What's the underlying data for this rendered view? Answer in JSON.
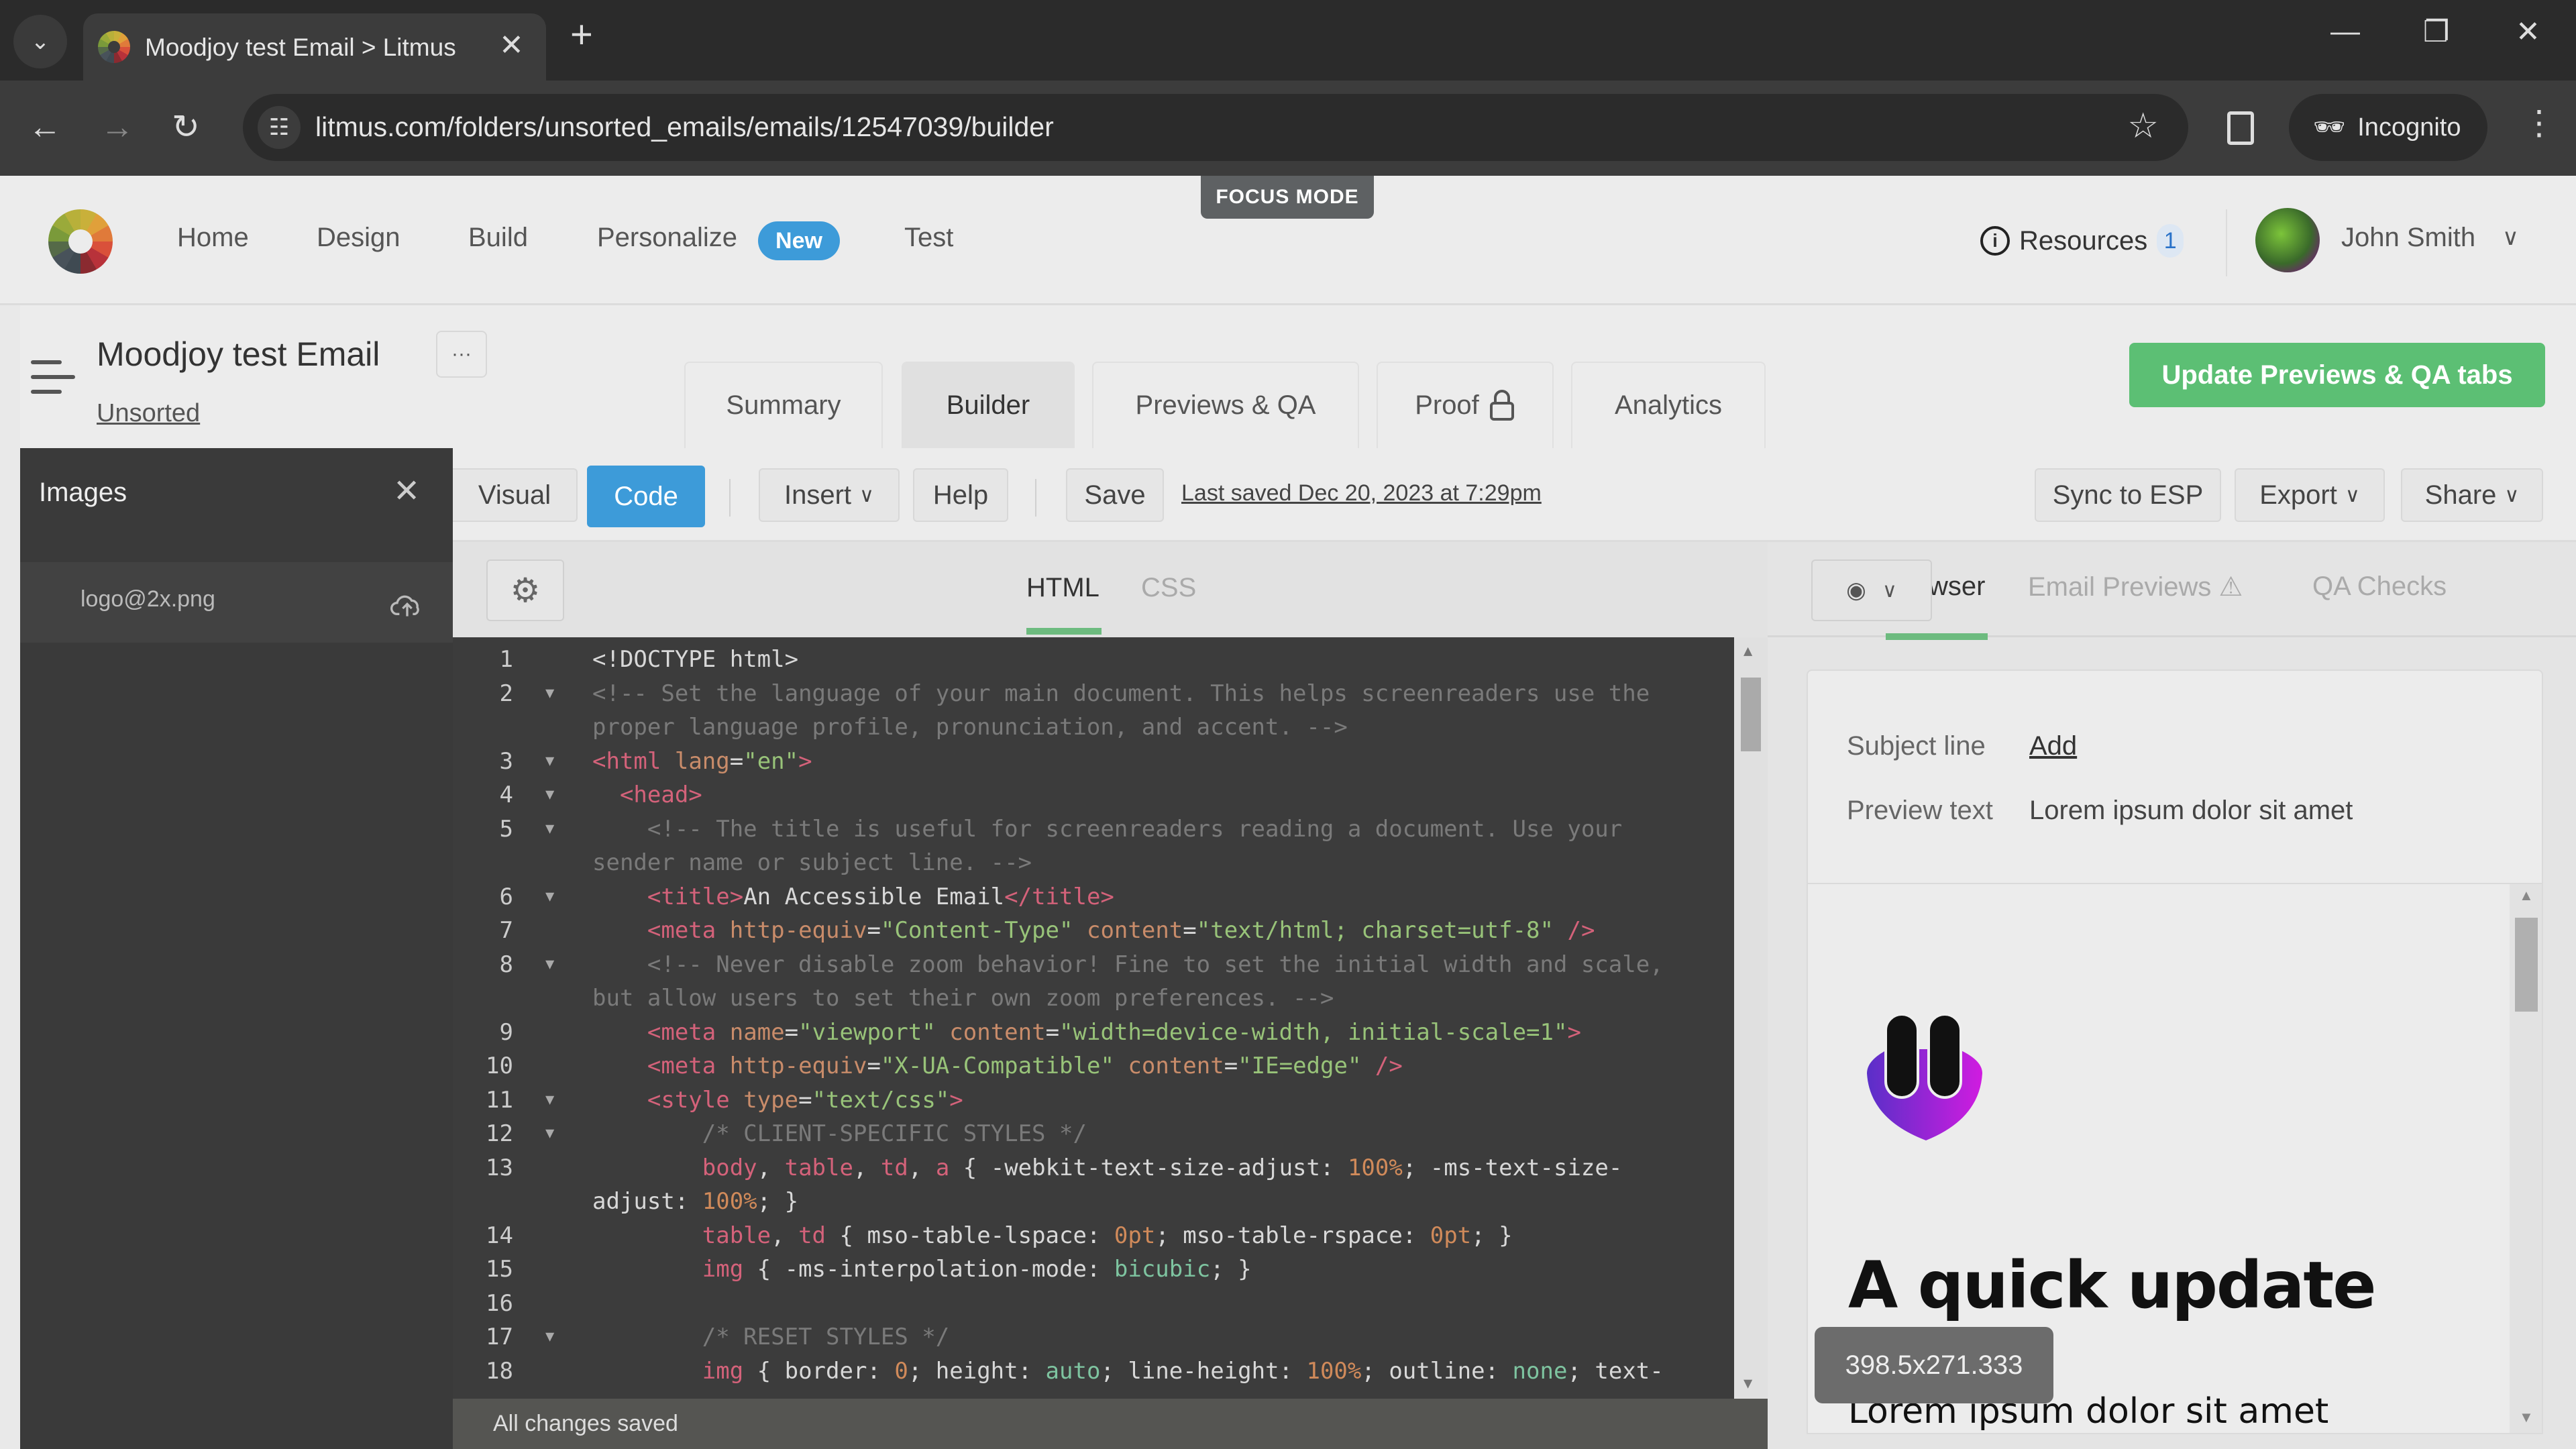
{
  "browser": {
    "tab_title": "Moodjoy test Email > Litmus",
    "url": "litmus.com/folders/unsorted_emails/emails/12547039/builder",
    "profile_label": "Incognito"
  },
  "app": {
    "nav": [
      "Home",
      "Design",
      "Build",
      "Personalize",
      "Test"
    ],
    "new_badge": "New",
    "focus_mode": "FOCUS MODE",
    "resources_label": "Resources",
    "resources_count": "1",
    "user_name": "John Smith"
  },
  "email": {
    "title": "Moodjoy test Email",
    "folder": "Unsorted",
    "more_label": "···",
    "tabs": [
      "Summary",
      "Builder",
      "Previews & QA",
      "Proof",
      "Analytics"
    ],
    "active_tab": "Builder",
    "update_button": "Update Previews & QA tabs"
  },
  "images_panel": {
    "title": "Images",
    "items": [
      {
        "name": "logo@2x.png"
      }
    ]
  },
  "toolbar": {
    "visual": "Visual",
    "code": "Code",
    "insert": "Insert",
    "help": "Help",
    "save": "Save",
    "last_saved": "Last saved Dec 20, 2023 at 7:29pm",
    "sync": "Sync to ESP",
    "export": "Export",
    "share": "Share"
  },
  "code_tabs": {
    "html": "HTML",
    "css": "CSS",
    "active": "HTML"
  },
  "editor": {
    "lines": [
      {
        "n": "1",
        "fold": false,
        "html": "<span>&lt;!DOCTYPE html&gt;</span>"
      },
      {
        "n": "2",
        "fold": true,
        "html": "<span class='c-com'>&lt;!-- Set the language of your main document. This helps screenreaders use the</span>"
      },
      {
        "n": "",
        "fold": false,
        "html": "<span class='c-com'>proper language profile, pronunciation, and accent. --&gt;</span>"
      },
      {
        "n": "3",
        "fold": true,
        "html": "<span class='c-tag'>&lt;html</span> <span class='c-attr'>lang</span>=<span class='c-str'>\"en\"</span><span class='c-tag'>&gt;</span>"
      },
      {
        "n": "4",
        "fold": true,
        "html": "  <span class='c-tag'>&lt;head&gt;</span>"
      },
      {
        "n": "5",
        "fold": true,
        "html": "    <span class='c-com'>&lt;!-- The title is useful for screenreaders reading a document. Use your</span>"
      },
      {
        "n": "",
        "fold": false,
        "html": "<span class='c-com'>sender name or subject line. --&gt;</span>"
      },
      {
        "n": "6",
        "fold": true,
        "html": "    <span class='c-tag'>&lt;title&gt;</span>An Accessible Email<span class='c-tag'>&lt;/title&gt;</span>"
      },
      {
        "n": "7",
        "fold": false,
        "html": "    <span class='c-tag'>&lt;meta</span> <span class='c-attr'>http-equiv</span>=<span class='c-str'>\"Content-Type\"</span> <span class='c-attr'>content</span>=<span class='c-str'>\"text/html; charset=utf-8\"</span> <span class='c-tag'>/&gt;</span>"
      },
      {
        "n": "8",
        "fold": true,
        "html": "    <span class='c-com'>&lt;!-- Never disable zoom behavior! Fine to set the initial width and scale,</span>"
      },
      {
        "n": "",
        "fold": false,
        "html": "<span class='c-com'>but allow users to set their own zoom preferences. --&gt;</span>"
      },
      {
        "n": "9",
        "fold": false,
        "html": "    <span class='c-tag'>&lt;meta</span> <span class='c-attr'>name</span>=<span class='c-str'>\"viewport\"</span> <span class='c-attr'>content</span>=<span class='c-str'>\"width=device-width, initial-scale=1\"</span><span class='c-tag'>&gt;</span>"
      },
      {
        "n": "10",
        "fold": false,
        "html": "    <span class='c-tag'>&lt;meta</span> <span class='c-attr'>http-equiv</span>=<span class='c-str'>\"X-UA-Compatible\"</span> <span class='c-attr'>content</span>=<span class='c-str'>\"IE=edge\"</span> <span class='c-tag'>/&gt;</span>"
      },
      {
        "n": "11",
        "fold": true,
        "html": "    <span class='c-tag'>&lt;style</span> <span class='c-attr'>type</span>=<span class='c-str'>\"text/css\"</span><span class='c-tag'>&gt;</span>"
      },
      {
        "n": "12",
        "fold": true,
        "html": "        <span class='c-com'>/* CLIENT-SPECIFIC STYLES */</span>"
      },
      {
        "n": "13",
        "fold": false,
        "html": "        <span class='c-tag'>body</span>, <span class='c-tag'>table</span>, <span class='c-tag'>td</span>, <span class='c-tag'>a</span> { -webkit-text-size-adjust: <span class='c-num'>100%</span>; -ms-text-size-"
      },
      {
        "n": "",
        "fold": false,
        "html": "adjust: <span class='c-num'>100%</span>; }"
      },
      {
        "n": "14",
        "fold": false,
        "html": "        <span class='c-tag'>table</span>, <span class='c-tag'>td</span> { mso-table-lspace: <span class='c-num'>0pt</span>; mso-table-rspace: <span class='c-num'>0pt</span>; }"
      },
      {
        "n": "15",
        "fold": false,
        "html": "        <span class='c-tag'>img</span> { -ms-interpolation-mode: <span class='c-val'>bicubic</span>; }"
      },
      {
        "n": "16",
        "fold": false,
        "html": ""
      },
      {
        "n": "17",
        "fold": true,
        "html": "        <span class='c-com'>/* RESET STYLES */</span>"
      },
      {
        "n": "18",
        "fold": false,
        "html": "        <span class='c-tag'>img</span> { border: <span class='c-num'>0</span>; height: <span class='c-val'>auto</span>; line-height: <span class='c-num'>100%</span>; outline: <span class='c-val'>none</span>; text-"
      }
    ],
    "status": "All changes saved"
  },
  "preview": {
    "tabs": [
      "wser",
      "Email Previews",
      "QA Checks"
    ],
    "active_tab": "wser",
    "subject_label": "Subject line",
    "subject_value": "Add",
    "preview_label": "Preview text",
    "preview_value": "Lorem ipsum dolor sit amet",
    "email_heading": "A quick update",
    "email_body": "Lorem ipsum dolor sit amet",
    "size_tooltip": "398.5x271.333"
  },
  "colors": {
    "accent_blue": "#3d9bd9",
    "accent_green": "#5cbf74",
    "tab_underline": "#6dbb7f"
  }
}
